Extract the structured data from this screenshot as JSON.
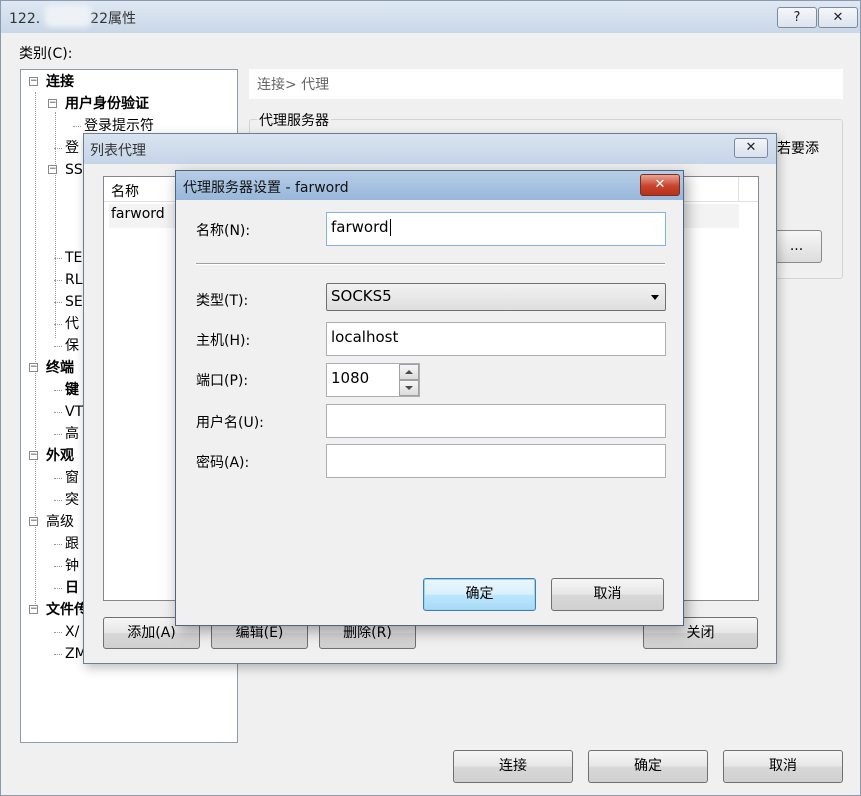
{
  "main": {
    "title_prefix": "122.",
    "title_suffix": "22属性",
    "help_label": "?",
    "close_label": "✕",
    "category_label": "类别(C):",
    "breadcrumb": "连接> 代理",
    "group_title": "代理服务器",
    "side_text": "若要添",
    "dots_label": "...",
    "tree": [
      {
        "label": "连接",
        "bold": true
      },
      {
        "label": "用户身份验证",
        "bold": true
      },
      {
        "label": "登录提示符",
        "bold": false
      },
      {
        "label": "登",
        "bold": false
      },
      {
        "label": "SS",
        "bold": false
      },
      {
        "label": "TE",
        "bold": false
      },
      {
        "label": "RL",
        "bold": false
      },
      {
        "label": "SE",
        "bold": false
      },
      {
        "label": "代",
        "bold": false
      },
      {
        "label": "保",
        "bold": false
      },
      {
        "label": "终端",
        "bold": true
      },
      {
        "label": "键",
        "bold": true
      },
      {
        "label": "VT",
        "bold": false
      },
      {
        "label": "高",
        "bold": false
      },
      {
        "label": "外观",
        "bold": true
      },
      {
        "label": "窗",
        "bold": false
      },
      {
        "label": "突",
        "bold": false
      },
      {
        "label": "高级",
        "bold": false
      },
      {
        "label": "跟",
        "bold": false
      },
      {
        "label": "钟",
        "bold": false
      },
      {
        "label": "日",
        "bold": true
      },
      {
        "label": "文件传",
        "bold": true
      },
      {
        "label": "X/",
        "bold": false
      },
      {
        "label": "ZM",
        "bold": false
      }
    ],
    "connect_button": "连接",
    "ok_button": "确定",
    "cancel_button": "取消"
  },
  "list_dialog": {
    "title": "列表代理",
    "close_label": "✕",
    "column_name": "名称",
    "rows": [
      "farword"
    ],
    "add_button": "添加(A)",
    "edit_button": "编辑(E)",
    "delete_button": "删除(R)",
    "close_button": "关闭"
  },
  "proxy_dialog": {
    "title": "代理服务器设置 - farword",
    "close_label": "✕",
    "name_label": "名称(N):",
    "name_value": "farword",
    "type_label": "类型(T):",
    "type_value": "SOCKS5",
    "host_label": "主机(H):",
    "host_value": "localhost",
    "port_label": "端口(P):",
    "port_value": "1080",
    "user_label": "用户名(U):",
    "user_value": "",
    "password_label": "密码(A):",
    "password_value": "",
    "ok_button": "确定",
    "cancel_button": "取消"
  }
}
